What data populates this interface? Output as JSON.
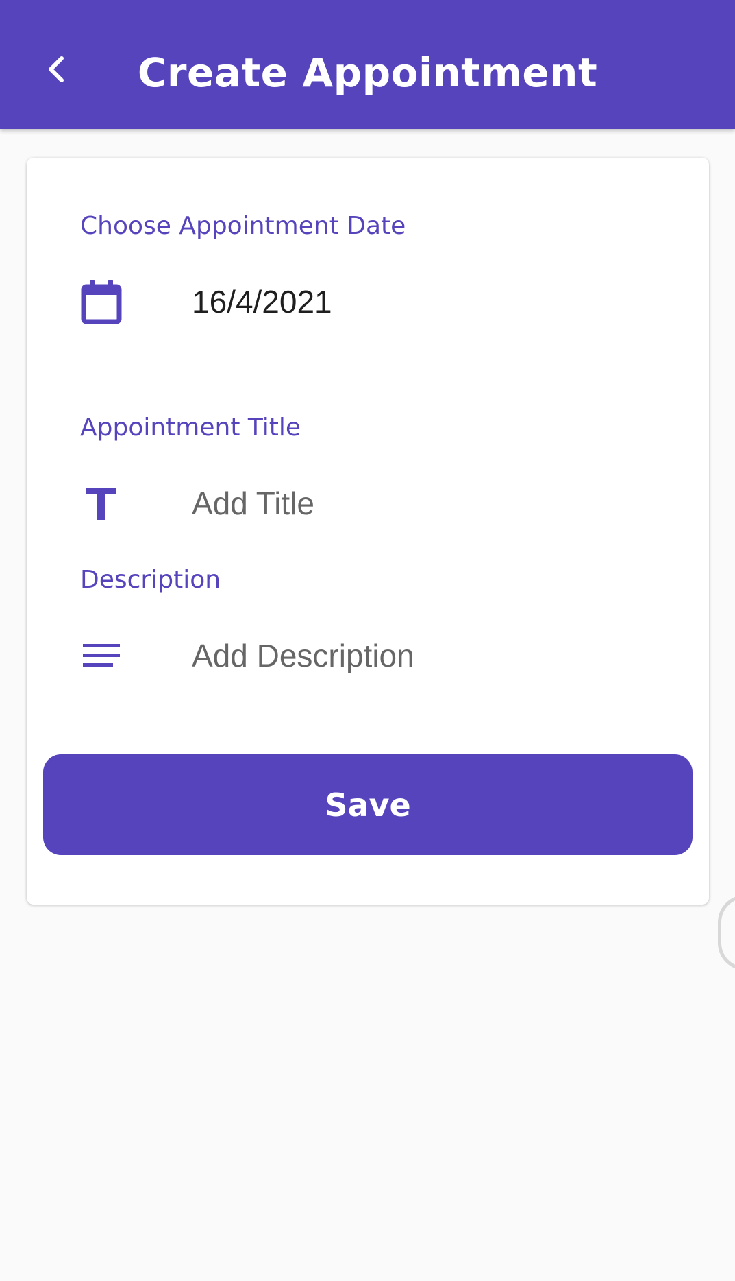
{
  "app_bar": {
    "title": "Create Appointment",
    "back_icon": "chevron-left-icon",
    "color": "#5644bc"
  },
  "form": {
    "date": {
      "label": "Choose Appointment Date",
      "icon": "calendar-icon",
      "value": "16/4/2021"
    },
    "title": {
      "label": "Appointment Title",
      "icon": "text-title-icon",
      "placeholder": "Add Title",
      "value": ""
    },
    "description": {
      "label": "Description",
      "icon": "notes-lines-icon",
      "placeholder": "Add Description",
      "value": ""
    },
    "save_label": "Save"
  },
  "colors": {
    "accent": "#5644bc",
    "background": "#fafafa",
    "card": "#ffffff",
    "placeholder": "#666666"
  }
}
